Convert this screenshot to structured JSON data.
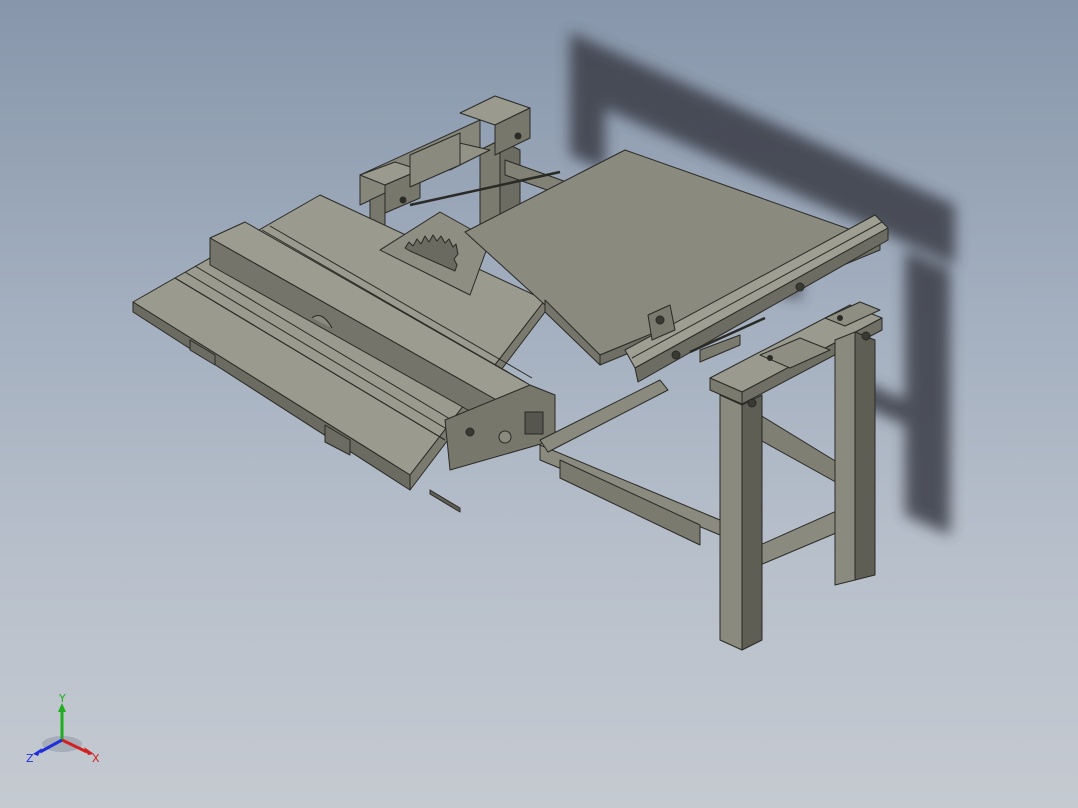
{
  "viewport": {
    "background_top": "#8796ab",
    "background_bottom": "#c5cad1",
    "model_color": "#8a8a7e",
    "edge_color": "#2a2a26",
    "shadow_color": "#3a3e46"
  },
  "triad": {
    "x_label": "X",
    "y_label": "Y",
    "z_label": "Z",
    "x_color": "#d42020",
    "y_color": "#1fae1f",
    "z_color": "#2030d8"
  }
}
